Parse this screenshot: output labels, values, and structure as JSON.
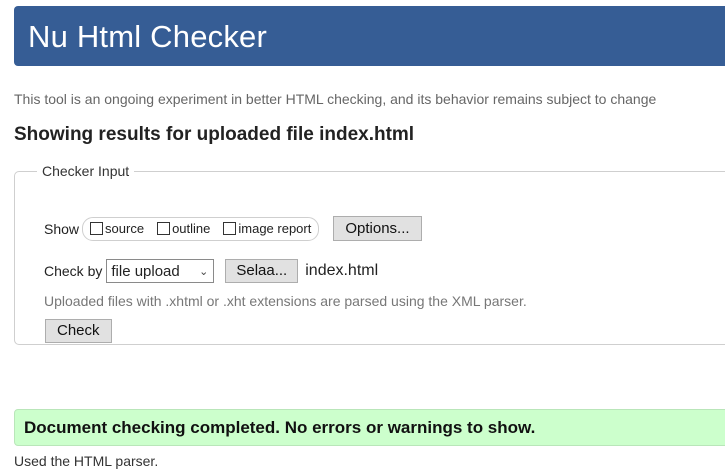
{
  "header": {
    "title": "Nu Html Checker"
  },
  "tagline": "This tool is an ongoing experiment in better HTML checking, and its behavior remains subject to change",
  "results_title": "Showing results for uploaded file index.html",
  "checker_input": {
    "legend": "Checker Input",
    "show_label": "Show",
    "show_options": [
      {
        "label": "source",
        "checked": false
      },
      {
        "label": "outline",
        "checked": false
      },
      {
        "label": "image report",
        "checked": false
      }
    ],
    "options_button": "Options...",
    "check_by_label": "Check by",
    "check_by_value": "file upload",
    "browse_button": "Selaa...",
    "filename": "index.html",
    "hint": "Uploaded files with .xhtml or .xht extensions are parsed using the XML parser.",
    "check_button": "Check"
  },
  "result_message": "Document checking completed. No errors or warnings to show.",
  "cutoff_text": "Used the HTML parser."
}
